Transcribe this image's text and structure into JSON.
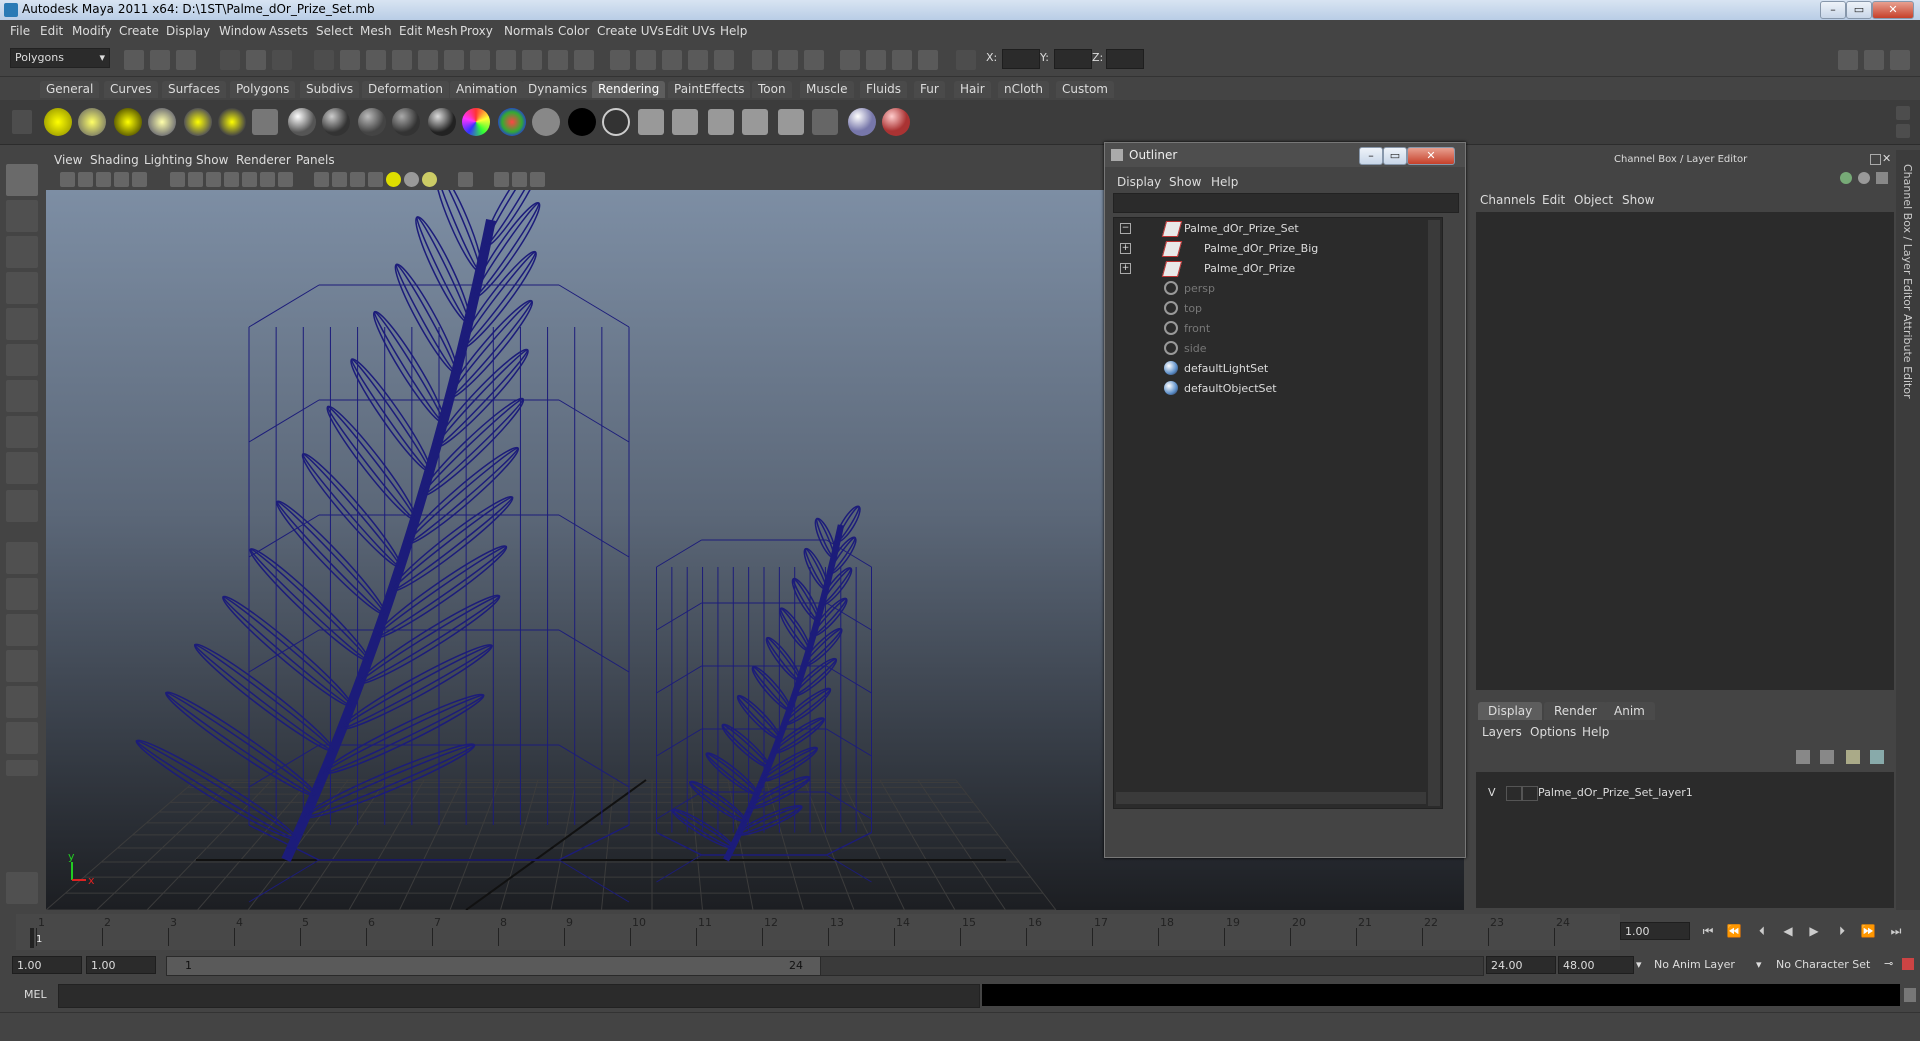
{
  "window": {
    "title": "Autodesk Maya 2011 x64: D:\\1ST\\Palme_dOr_Prize_Set.mb"
  },
  "menubar": [
    "File",
    "Edit",
    "Modify",
    "Create",
    "Display",
    "Window",
    "Assets",
    "Select",
    "Mesh",
    "Edit Mesh",
    "Proxy",
    "Normals",
    "Color",
    "Create UVs",
    "Edit UVs",
    "Help"
  ],
  "statusline": {
    "mode": "Polygons",
    "x_label": "X:",
    "y_label": "Y:",
    "z_label": "Z:"
  },
  "shelf": {
    "tabs": [
      "General",
      "Curves",
      "Surfaces",
      "Polygons",
      "Subdivs",
      "Deformation",
      "Animation",
      "Dynamics",
      "Rendering",
      "PaintEffects",
      "Toon",
      "Muscle",
      "Fluids",
      "Fur",
      "Hair",
      "nCloth",
      "Custom"
    ],
    "active_tab": "Rendering"
  },
  "viewport": {
    "menu": [
      "View",
      "Shading",
      "Lighting",
      "Show",
      "Renderer",
      "Panels"
    ],
    "axis_y": "y",
    "axis_x": "x",
    "wire_color": "#1c1c7a",
    "grid_color": "#3c3c3c"
  },
  "outliner": {
    "title": "Outliner",
    "menu": [
      "Display",
      "Show",
      "Help"
    ],
    "items": [
      {
        "label": "Palme_dOr_Prize_Set",
        "type": "set",
        "expander": "−",
        "dim": false
      },
      {
        "label": "Palme_dOr_Prize_Big",
        "type": "set",
        "expander": "+",
        "dim": false
      },
      {
        "label": "Palme_dOr_Prize",
        "type": "set",
        "expander": "+",
        "dim": false
      },
      {
        "label": "persp",
        "type": "cam",
        "expander": "",
        "dim": true
      },
      {
        "label": "top",
        "type": "cam",
        "expander": "",
        "dim": true
      },
      {
        "label": "front",
        "type": "cam",
        "expander": "",
        "dim": true
      },
      {
        "label": "side",
        "type": "cam",
        "expander": "",
        "dim": true
      },
      {
        "label": "defaultLightSet",
        "type": "light",
        "expander": "",
        "dim": false
      },
      {
        "label": "defaultObjectSet",
        "type": "light",
        "expander": "",
        "dim": false
      }
    ]
  },
  "channelbox": {
    "title": "Channel Box / Layer Editor",
    "menu": [
      "Channels",
      "Edit",
      "Object",
      "Show"
    ],
    "layer_tabs": [
      "Display",
      "Render",
      "Anim"
    ],
    "layer_menu": [
      "Layers",
      "Options",
      "Help"
    ],
    "layer": {
      "visibility": "V",
      "name": "Palme_dOr_Prize_Set_layer1"
    }
  },
  "sidetabs": [
    "Channel Box / Layer Editor",
    "Attribute Editor"
  ],
  "timeslider": {
    "ticks": [
      "1",
      "2",
      "3",
      "4",
      "5",
      "6",
      "7",
      "8",
      "9",
      "10",
      "11",
      "12",
      "13",
      "14",
      "15",
      "16",
      "17",
      "18",
      "19",
      "20",
      "21",
      "22",
      "23",
      "24"
    ],
    "current_frame": "1",
    "current_time": "1.00"
  },
  "range": {
    "start": "1.00",
    "playback_start": "1.00",
    "range_start": "1",
    "range_end": "24",
    "playback_end": "24.00",
    "end": "48.00",
    "anim_layer": "No Anim Layer",
    "character_set": "No Character Set"
  },
  "cmdline": {
    "label": "MEL"
  }
}
